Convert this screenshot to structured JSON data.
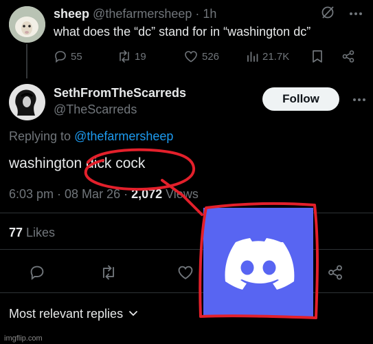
{
  "parent_tweet": {
    "display_name": "sheep",
    "handle": "@thefarmersheep",
    "separator": "·",
    "time": "1h",
    "text": "what does the “dc” stand for in “washington dc”",
    "stats": {
      "replies": "55",
      "reposts": "19",
      "likes": "526",
      "views": "21.7K"
    }
  },
  "reply_tweet": {
    "display_name": "SethFromTheScarreds",
    "handle": "@TheScarreds",
    "follow_label": "Follow",
    "replying_prefix": "Replying to ",
    "replying_handle": "@thefarmersheep",
    "text": "washington dick cock",
    "timestamp": "6:03 pm · 08 Mar 26 · ",
    "views_count": "2,072",
    "views_label": " Views",
    "likes_count": "77",
    "likes_label": " Likes"
  },
  "replies_sort": {
    "label": "Most relevant replies"
  },
  "watermark": "imgflip.com",
  "colors": {
    "accent": "#1d9bf0",
    "discord": "#5865f2",
    "annotation": "#e3202b"
  },
  "icons": [
    "grok-icon",
    "more-icon",
    "reply-icon",
    "repost-icon",
    "like-icon",
    "views-icon",
    "bookmark-icon",
    "share-icon",
    "discord-logo-icon",
    "chevron-down-icon"
  ]
}
